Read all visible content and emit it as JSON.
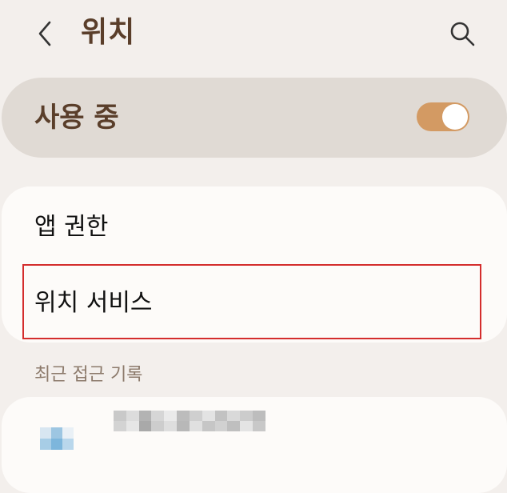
{
  "header": {
    "title": "위치",
    "back_icon": "chevron-left-icon",
    "search_icon": "search-icon"
  },
  "master_switch": {
    "label": "사용 중",
    "checked": true
  },
  "menu": {
    "items": [
      {
        "label": "앱 권한"
      },
      {
        "label": "위치 서비스"
      }
    ]
  },
  "recent_access": {
    "header": "최근 접근 기록"
  },
  "colors": {
    "background": "#f3efec",
    "title": "#5a3e2a",
    "master_row": "#e0dad4",
    "toggle_on": "#d39a63",
    "card": "#fdfbf9",
    "highlight": "#d42d2d",
    "section_header": "#8c7a6b"
  }
}
